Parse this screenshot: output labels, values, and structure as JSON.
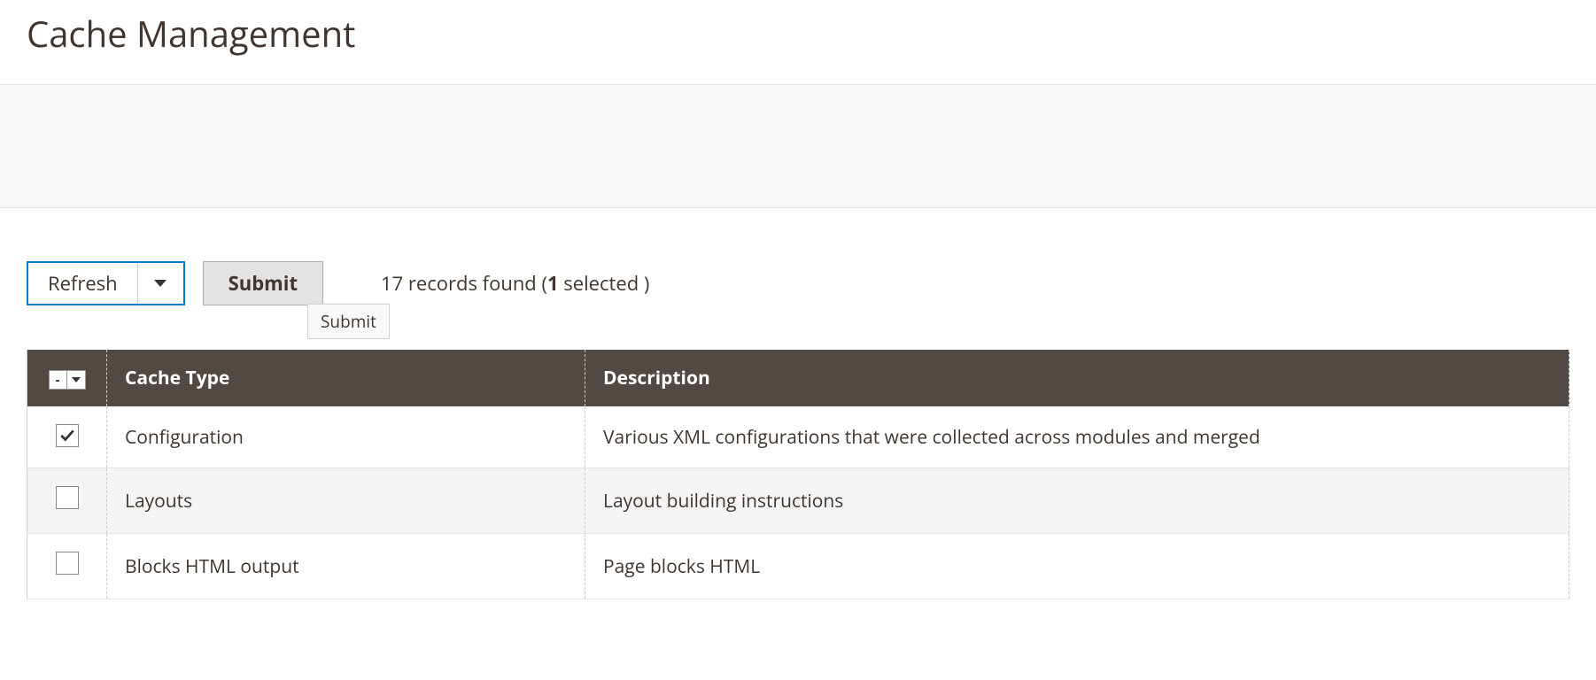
{
  "page": {
    "title": "Cache Management"
  },
  "toolbar": {
    "action_select_label": "Refresh",
    "submit_label": "Submit",
    "tooltip_text": "Submit",
    "records_found_count": "17",
    "records_found_text": " records found (",
    "records_selected_count": "1",
    "records_selected_text": " selected )"
  },
  "table": {
    "select_checkbox_symbol": "-",
    "columns": {
      "cache_type": "Cache Type",
      "description": "Description"
    },
    "rows": [
      {
        "checked": true,
        "cache_type": "Configuration",
        "description": "Various XML configurations that were collected across modules and merged"
      },
      {
        "checked": false,
        "cache_type": "Layouts",
        "description": "Layout building instructions"
      },
      {
        "checked": false,
        "cache_type": "Blocks HTML output",
        "description": "Page blocks HTML"
      }
    ]
  }
}
